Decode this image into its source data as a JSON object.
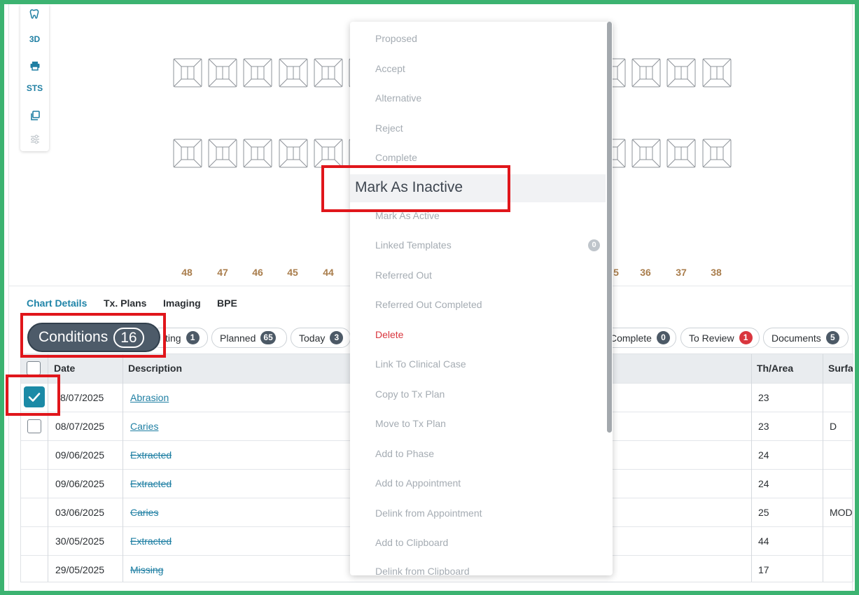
{
  "toolbar": {
    "tools": [
      {
        "icon": "tooth-icon"
      },
      {
        "label": "3D"
      },
      {
        "icon": "printer-icon"
      },
      {
        "label": "STS"
      },
      {
        "icon": "copy-icon"
      },
      {
        "icon": "sliders-icon"
      }
    ]
  },
  "tooth_numbers": {
    "left": [
      "48",
      "47",
      "46",
      "45",
      "44"
    ],
    "right": [
      "5",
      "36",
      "37",
      "38"
    ]
  },
  "tabs": [
    {
      "label": "Chart Details",
      "active": true
    },
    {
      "label": "Tx. Plans"
    },
    {
      "label": "Imaging"
    },
    {
      "label": "BPE"
    }
  ],
  "filters": {
    "conditions": {
      "label": "Conditions",
      "count": "16"
    },
    "pills": [
      {
        "label": "ting",
        "count": "1"
      },
      {
        "label": "Planned",
        "count": "65"
      },
      {
        "label": "Today",
        "count": "3"
      },
      {
        "label": "Complete",
        "count": "0"
      },
      {
        "label": "To Review",
        "count": "1",
        "color": "#d9363e"
      },
      {
        "label": "Documents",
        "count": "5"
      }
    ]
  },
  "table": {
    "columns": [
      "Date",
      "Description",
      "Th/Area",
      "Surfac"
    ],
    "rows": [
      {
        "date": "8/07/2025",
        "description": "Abrasion",
        "th_area": "23",
        "surface": "",
        "checked": true,
        "style": "link"
      },
      {
        "date": "08/07/2025",
        "description": "Caries",
        "th_area": "23",
        "surface": "D",
        "checked": false,
        "style": "link"
      },
      {
        "date": "09/06/2025",
        "description": "Extracted",
        "th_area": "24",
        "surface": "",
        "style": "strike"
      },
      {
        "date": "09/06/2025",
        "description": "Extracted",
        "th_area": "24",
        "surface": "",
        "style": "strike"
      },
      {
        "date": "03/06/2025",
        "description": "Caries",
        "th_area": "25",
        "surface": "MOD",
        "style": "strike"
      },
      {
        "date": "30/05/2025",
        "description": "Extracted",
        "th_area": "44",
        "surface": "",
        "style": "strike"
      },
      {
        "date": "29/05/2025",
        "description": "Missing",
        "th_area": "17",
        "surface": "",
        "style": "strike"
      }
    ]
  },
  "context_menu": {
    "items": [
      {
        "label": "Proposed"
      },
      {
        "label": "Accept"
      },
      {
        "label": "Alternative"
      },
      {
        "label": "Reject"
      },
      {
        "label": "Complete"
      },
      {
        "label": "Mark As Inactive",
        "highlighted": true
      },
      {
        "label": "Mark As Active"
      },
      {
        "label": "Linked Templates",
        "count": "0"
      },
      {
        "label": "Referred Out"
      },
      {
        "label": "Referred Out Completed"
      },
      {
        "label": "Delete",
        "danger": true
      },
      {
        "label": "Link To Clinical Case"
      },
      {
        "label": "Copy to Tx Plan"
      },
      {
        "label": "Move to Tx Plan"
      },
      {
        "label": "Add to Phase"
      },
      {
        "label": "Add to Appointment"
      },
      {
        "label": "Delink from Appointment"
      },
      {
        "label": "Add to Clipboard"
      },
      {
        "label": "Delink from Clipboard"
      }
    ]
  },
  "colors": {
    "frame": "#3cb371",
    "accent": "#1f84a8",
    "highlight_box": "#e0161b",
    "tooth_number": "#a97d4c"
  }
}
